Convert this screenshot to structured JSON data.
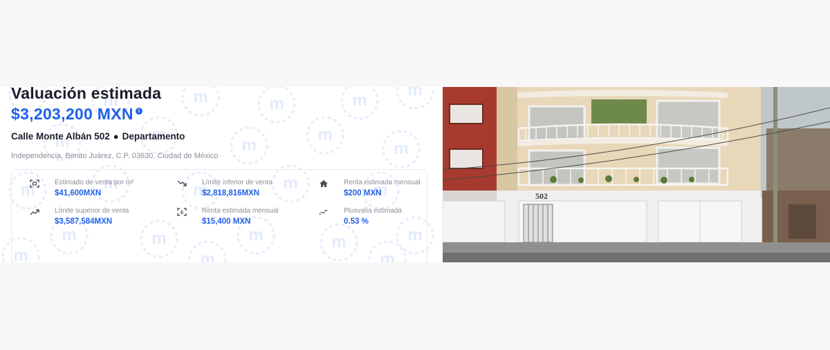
{
  "valuation": {
    "title": "Valuación estimada",
    "price": "$3,203,200 MXN",
    "info_icon": "info-icon",
    "street": "Calle Monte Albán 502",
    "separator": "●",
    "property_type": "Departamento",
    "location": "Independencia, Benito Juárez, C.P. 03630, Ciudad de México"
  },
  "stats": [
    {
      "icon": "scan-area-icon",
      "label": "Estimado de venta por m²",
      "value": "$41,600MXN"
    },
    {
      "icon": "trend-down-icon",
      "label": "Límite inferior de venta",
      "value": "$2,818,816MXN"
    },
    {
      "icon": "house-icon",
      "label": "Renta estimada mensual",
      "value": "$200 MXN"
    },
    {
      "icon": "trend-up-icon",
      "label": "Límite superior de venta",
      "value": "$3,587,584MXN"
    },
    {
      "icon": "money-scan-icon",
      "label": "Renta estimada mensual",
      "value": "$15,400 MXN"
    },
    {
      "icon": "chart-line-icon",
      "label": "Plusvalía estimada",
      "value": "0.53 %"
    }
  ],
  "photo": {
    "building_number": "502"
  },
  "colors": {
    "accent": "#1e60e8",
    "text_dark": "#1c1c2b",
    "text_muted": "#8c8c99"
  }
}
